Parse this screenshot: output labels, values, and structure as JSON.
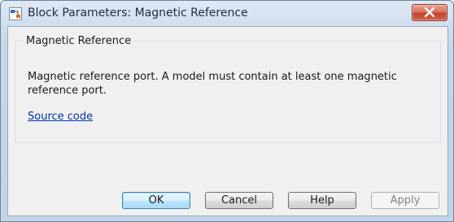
{
  "window": {
    "title": "Block Parameters: Magnetic Reference"
  },
  "group": {
    "title": "Magnetic Reference",
    "description": "Magnetic reference port. A model must contain at least one magnetic reference port.",
    "link_label": "Source code"
  },
  "buttons": {
    "ok": "OK",
    "cancel": "Cancel",
    "help": "Help",
    "apply": "Apply"
  },
  "colors": {
    "link": "#0033aa",
    "close_button": "#c0432a",
    "default_button_border": "#3c7fb1"
  },
  "icons": {
    "app": "simulink-block-icon",
    "close": "close-icon"
  }
}
